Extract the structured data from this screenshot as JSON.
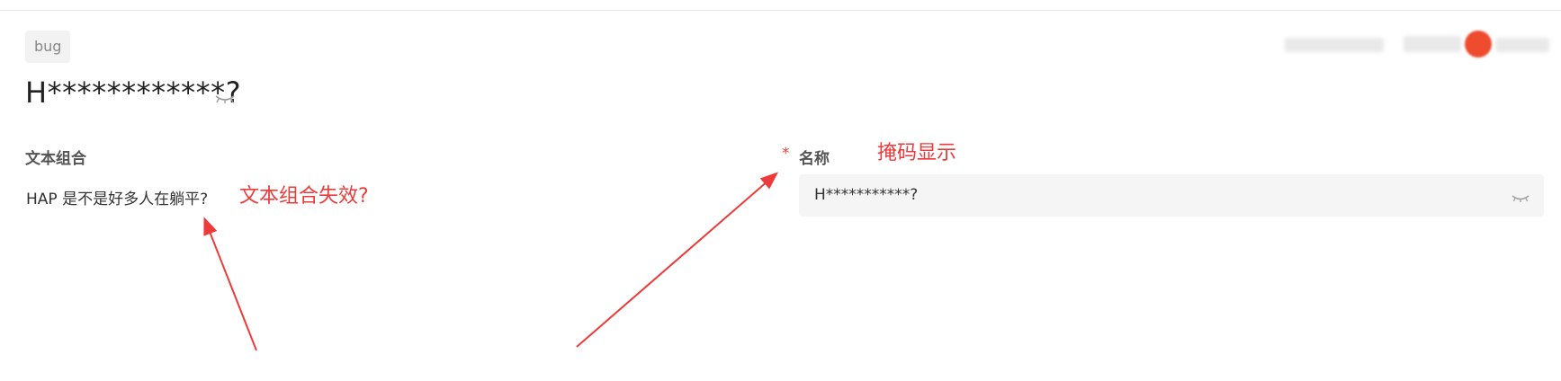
{
  "header": {
    "tag_label": "bug"
  },
  "record": {
    "title": "H************?"
  },
  "fields": {
    "text_combo": {
      "label": "文本组合",
      "value": "HAP 是不是好多人在躺平?"
    },
    "name": {
      "required_mark": "*",
      "label": "名称",
      "value": "H***********?"
    }
  },
  "annotations": {
    "left_note": "文本组合失效?",
    "right_note": "掩码显示",
    "color": "#ee3a3a"
  },
  "icons": {
    "title_eye": "eye-closed-icon",
    "field_eye": "eye-closed-icon"
  }
}
